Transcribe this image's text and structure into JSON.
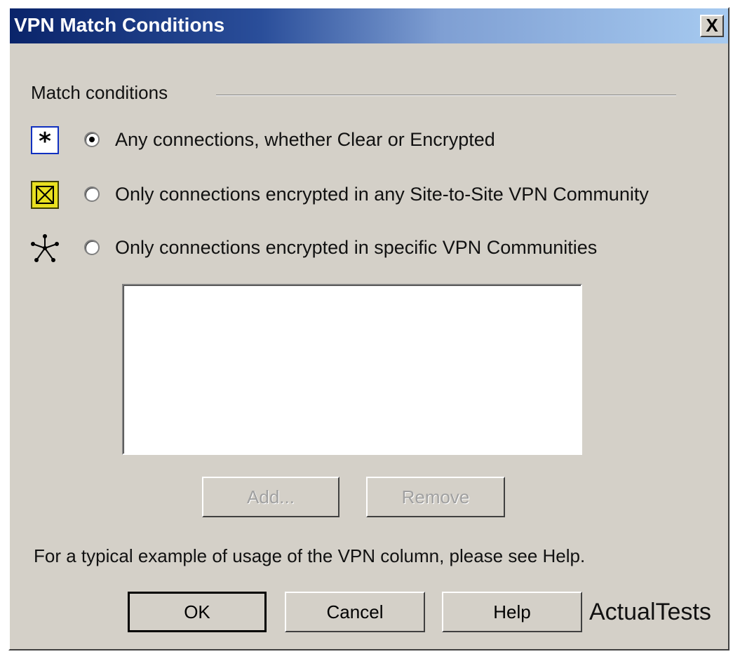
{
  "window": {
    "title": "VPN Match Conditions",
    "close_label": "X"
  },
  "group": {
    "label": "Match conditions"
  },
  "options": [
    {
      "label": "Any connections, whether Clear or Encrypted",
      "icon": "asterisk-icon",
      "checked": true
    },
    {
      "label": "Only connections encrypted in any Site-to-Site VPN Community",
      "icon": "community-box-icon",
      "checked": false
    },
    {
      "label": "Only connections encrypted in specific VPN Communities",
      "icon": "star-network-icon",
      "checked": false
    }
  ],
  "list": {
    "items": []
  },
  "list_buttons": {
    "add_label": "Add...",
    "remove_label": "Remove"
  },
  "info": {
    "text": "For a typical example of usage of the VPN column, please see Help."
  },
  "footer_buttons": {
    "ok_label": "OK",
    "cancel_label": "Cancel",
    "help_label": "Help"
  },
  "watermark": "ActualTests"
}
